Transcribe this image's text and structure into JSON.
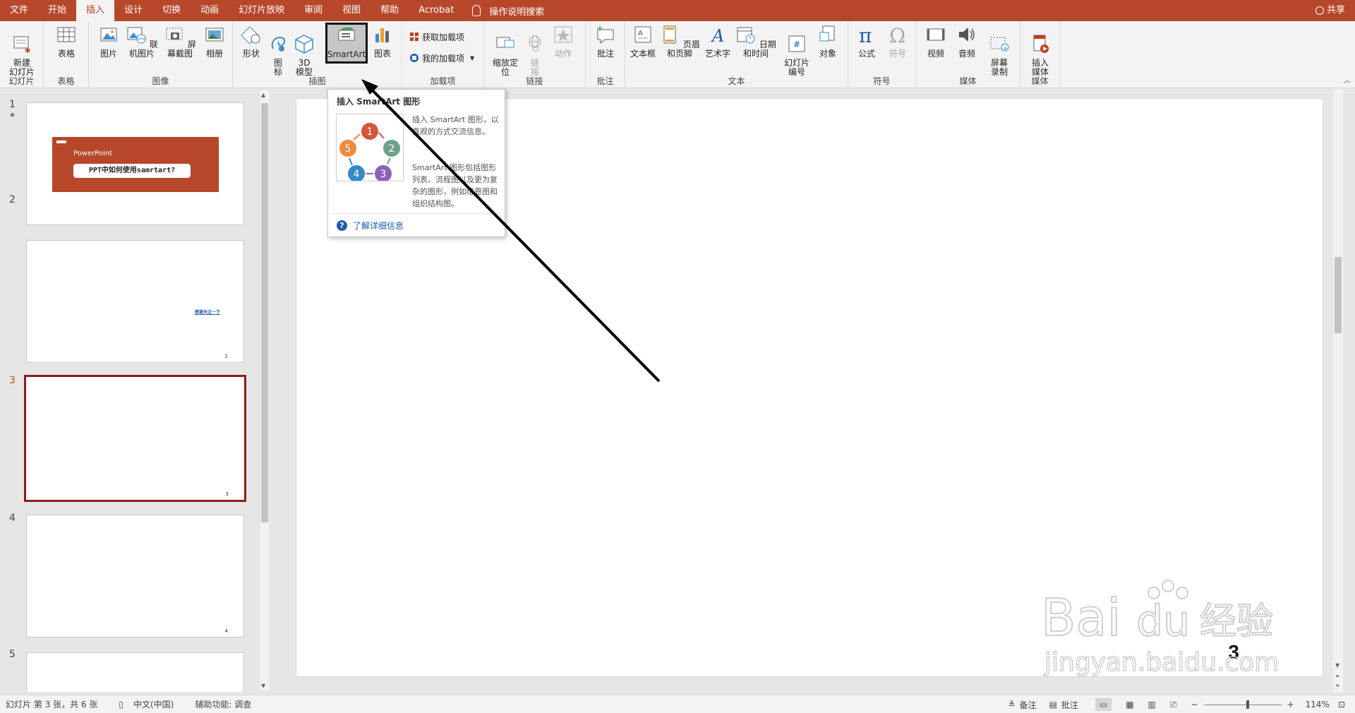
{
  "tabs": [
    "文件",
    "开始",
    "插入",
    "设计",
    "切换",
    "动画",
    "幻灯片放映",
    "审阅",
    "视图",
    "帮助",
    "Acrobat"
  ],
  "active_tab": "插入",
  "tell_me": "操作说明搜索",
  "share": "共享",
  "ribbon": {
    "groups": {
      "slides": "幻灯片",
      "tables": "表格",
      "images": "图像",
      "illustrations": "插图",
      "addins": "加载项",
      "links": "链接",
      "comments": "批注",
      "text": "文本",
      "symbols": "符号",
      "media": "媒体",
      "media2": "媒体"
    },
    "buttons": {
      "new_slide": "新建\n幻灯片",
      "table": "表格",
      "picture": "图片",
      "online_picture": "联机图片",
      "screenshot": "屏幕截图",
      "album": "相册",
      "shapes": "形状",
      "icons": "图\n标",
      "model3d": "3D\n模型",
      "smartart": "SmartArt",
      "chart": "图表",
      "get_addins": "获取加载项",
      "my_addins": "我的加载项",
      "zoom": "缩放定\n位",
      "link": "链\n接",
      "action": "动作",
      "comment": "批注",
      "textbox": "文本框",
      "header_footer": "页眉和页脚",
      "wordart": "艺术字",
      "datetime": "日期和时间",
      "slide_number": "幻灯片\n编号",
      "object": "对象",
      "equation": "公式",
      "symbol": "符号",
      "video": "视频",
      "audio": "音频",
      "screen_record": "屏幕\n录制",
      "insert_media": "插入\n媒体"
    }
  },
  "tooltip": {
    "title": "插入 SmartArt 图形",
    "desc1": "插入 SmartArt 图形，以直观的方式交流信息。",
    "desc2": "SmartArt 图形包括图形列表、流程图以及更为复杂的图形，例如维恩图和组织结构图。",
    "learn_more": "了解详细信息",
    "diagram_numbers": [
      "1",
      "2",
      "3",
      "4",
      "5"
    ]
  },
  "slides": [
    {
      "num": "1",
      "title_small": "PowerPoint",
      "title_main": "PPT中如何使用samrtart?"
    },
    {
      "num": "2",
      "text": "感谢关注一下",
      "page": "2"
    },
    {
      "num": "3",
      "page": "3"
    },
    {
      "num": "4",
      "page": "4"
    },
    {
      "num": "5"
    }
  ],
  "current_slide_number": "3",
  "status": {
    "slide_info": "幻灯片 第 3 张，共 6 张",
    "language": "中文(中国)",
    "accessibility": "辅助功能: 调查",
    "notes": "备注",
    "comments": "批注",
    "zoom": "114%"
  },
  "colors": {
    "accent": "#b7472a",
    "ribbon_bg": "#f3f3f3",
    "current_thumb_border": "#8b1d1d"
  }
}
